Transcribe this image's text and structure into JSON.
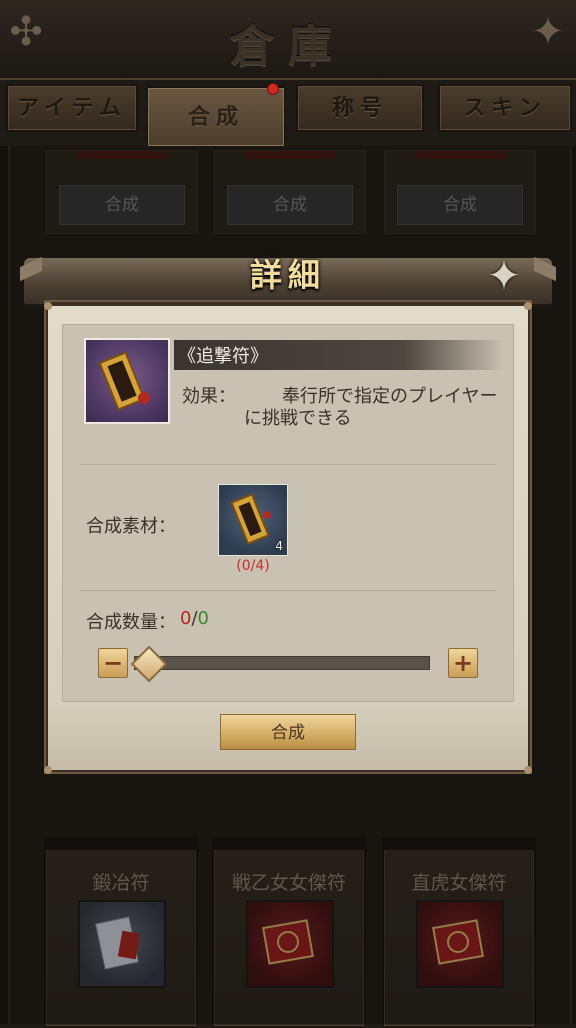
{
  "header": {
    "title": "倉庫"
  },
  "tabs": [
    {
      "label": "アイテム",
      "active": false
    },
    {
      "label": "合成",
      "active": true,
      "badge": true
    },
    {
      "label": "称号",
      "active": false
    },
    {
      "label": "スキン",
      "active": false
    }
  ],
  "background_cards": {
    "button_label": "合成",
    "bottom_items": [
      {
        "name": "鍛冶符"
      },
      {
        "name": "戦乙女女傑符"
      },
      {
        "name": "直虎女傑符"
      }
    ]
  },
  "modal": {
    "title": "詳細",
    "item": {
      "name": "《追撃符》",
      "effect_label": "効果：",
      "effect_line1": "奉行所で指定のプレイヤー",
      "effect_line2": "に挑戦できる"
    },
    "materials": {
      "label": "合成素材：",
      "count": "4",
      "progress": "(0/4)"
    },
    "quantity": {
      "label": "合成数量：",
      "current": "0",
      "separator": "/",
      "max": "0",
      "slider_fraction": 0
    },
    "minus_symbol": "−",
    "plus_symbol": "+",
    "confirm_label": "合成"
  },
  "colors": {
    "accent_gold": "#d3ab62",
    "title_gold": "#f2dc9e",
    "quantity_red": "#b4261e",
    "quantity_green": "#3a8a2a",
    "badge_red": "#d22a23"
  }
}
